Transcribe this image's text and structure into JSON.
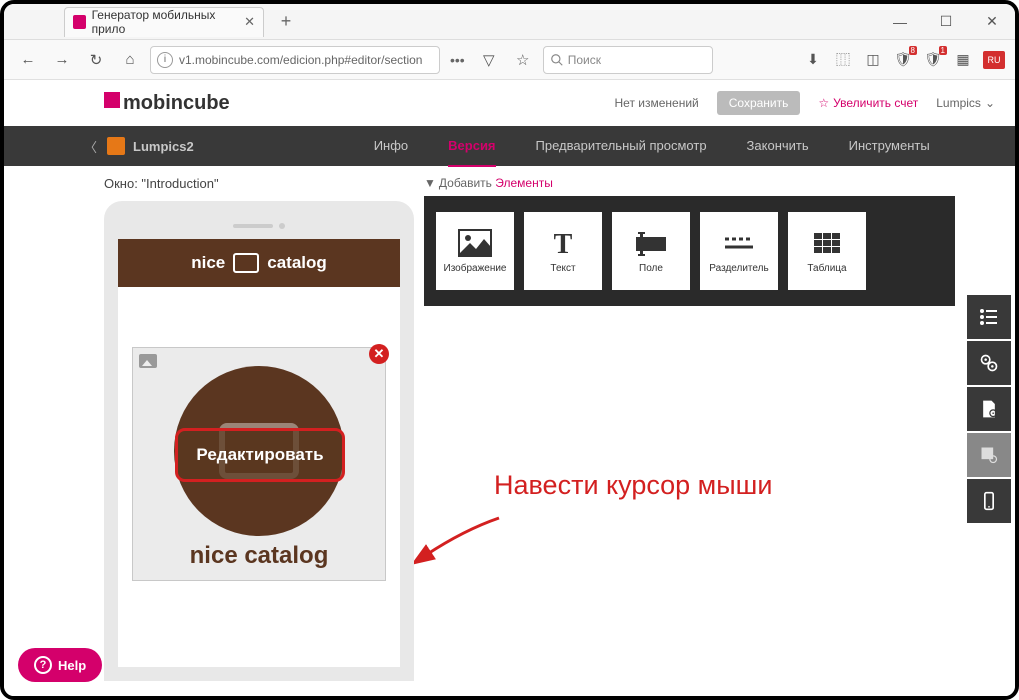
{
  "browser": {
    "tab_title": "Генератор мобильных прило",
    "url": "v1.mobincube.com/edicion.php#editor/section",
    "search_placeholder": "Поиск"
  },
  "header": {
    "logo": "mobincube",
    "no_changes": "Нет изменений",
    "save": "Сохранить",
    "upgrade": "Увеличить счет",
    "user": "Lumpics"
  },
  "nav": {
    "app": "Lumpics2",
    "tabs": {
      "info": "Инфо",
      "version": "Версия",
      "preview": "Предварительный просмотр",
      "finish": "Закончить",
      "tools": "Инструменты"
    }
  },
  "editor": {
    "window_label": "Окно: \"Introduction\"",
    "add_label": "Добавить ",
    "add_elements": "Элементы"
  },
  "elements": {
    "image": "Изображение",
    "text": "Текст",
    "field": "Поле",
    "divider": "Разделитель",
    "table": "Таблица"
  },
  "phone": {
    "title_left": "nice",
    "title_right": "catalog",
    "edit": "Редактировать",
    "card_label": "nice catalog"
  },
  "annotation": "Навести курсор мыши",
  "help": "Help"
}
